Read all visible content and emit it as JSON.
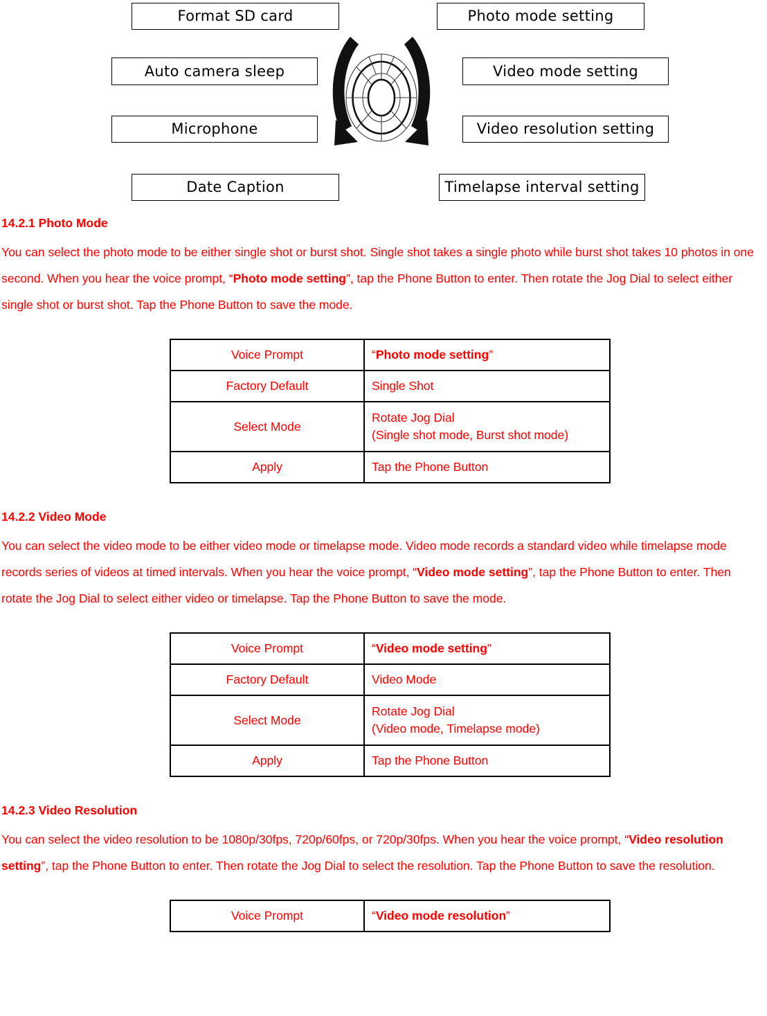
{
  "diagram": {
    "left_boxes": [
      {
        "label": "Format SD card"
      },
      {
        "label": "Auto camera sleep"
      },
      {
        "label": "Microphone"
      },
      {
        "label": "Date Caption"
      }
    ],
    "right_boxes": [
      {
        "label": "Photo mode setting"
      },
      {
        "label": "Video mode setting"
      },
      {
        "label": "Video resolution setting"
      },
      {
        "label": "Timelapse interval setting"
      }
    ],
    "center_icon": "jog-dial-wheel-with-rotation-arrows"
  },
  "sections": [
    {
      "heading": "14.2.1 Photo Mode",
      "paragraph_pre": "You can select the photo mode to be either single shot or burst shot. Single shot takes a single photo while burst shot takes 10 photos in one second. When you hear the voice prompt, “",
      "paragraph_bold": "Photo mode setting",
      "paragraph_post": "”, tap the Phone Button to enter. Then rotate the Jog Dial to select either single shot or burst shot. Tap the Phone Button to save the mode.",
      "table": {
        "rows": [
          {
            "label": "Voice Prompt",
            "value_pre": "“",
            "value_bold": "Photo mode setting",
            "value_post": "”",
            "value_line2": ""
          },
          {
            "label": "Factory Default",
            "value_pre": "Single Shot",
            "value_bold": "",
            "value_post": "",
            "value_line2": ""
          },
          {
            "label": "Select Mode",
            "value_pre": "Rotate Jog Dial",
            "value_bold": "",
            "value_post": "",
            "value_line2": "(Single shot mode, Burst shot mode)"
          },
          {
            "label": "Apply",
            "value_pre": "Tap the Phone Button",
            "value_bold": "",
            "value_post": "",
            "value_line2": ""
          }
        ]
      }
    },
    {
      "heading": "14.2.2 Video Mode",
      "paragraph_pre": "You can select the video mode to be either video mode or timelapse mode. Video mode records a standard video while timelapse mode records series of videos at timed intervals. When you hear the voice prompt, “",
      "paragraph_bold": "Video mode setting",
      "paragraph_post": "”, tap the Phone Button to enter. Then rotate the Jog Dial to select either video or timelapse. Tap the Phone Button to save the mode.",
      "table": {
        "rows": [
          {
            "label": "Voice Prompt",
            "value_pre": "“",
            "value_bold": "Video mode setting",
            "value_post": "”",
            "value_line2": ""
          },
          {
            "label": "Factory Default",
            "value_pre": "Video Mode",
            "value_bold": "",
            "value_post": "",
            "value_line2": ""
          },
          {
            "label": "Select Mode",
            "value_pre": "Rotate Jog Dial",
            "value_bold": "",
            "value_post": "",
            "value_line2": "(Video mode, Timelapse mode)"
          },
          {
            "label": "Apply",
            "value_pre": "Tap the Phone Button",
            "value_bold": "",
            "value_post": "",
            "value_line2": ""
          }
        ]
      }
    },
    {
      "heading": "14.2.3 Video Resolution",
      "paragraph_pre": "You can select the video resolution to be 1080p/30fps, 720p/60fps, or 720p/30fps. When you hear the voice prompt, “",
      "paragraph_bold": "Video resolution setting",
      "paragraph_post": "”, tap the Phone Button to enter. Then rotate the Jog Dial to select the resolution. Tap the Phone Button to save the resolution.",
      "table": {
        "rows": [
          {
            "label": "Voice Prompt",
            "value_pre": "“",
            "value_bold": "Video mode resolution",
            "value_post": "”",
            "value_line2": ""
          }
        ]
      }
    }
  ],
  "colors": {
    "text_red": "#ff0000",
    "diagram_line": "#000000",
    "background": "#ffffff"
  }
}
